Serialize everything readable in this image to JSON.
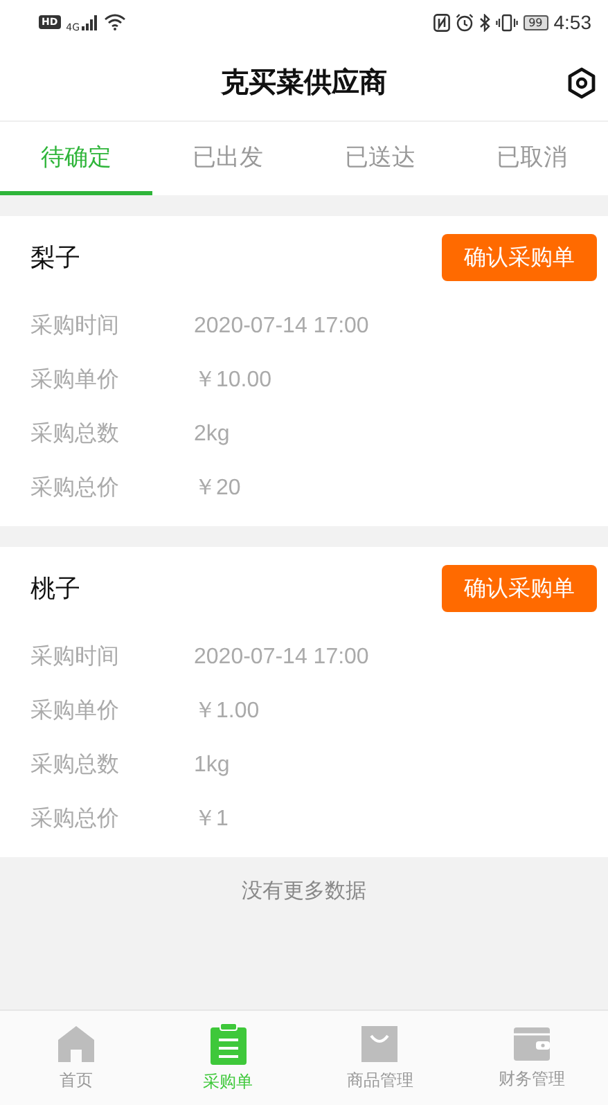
{
  "status_bar": {
    "hd": "HD",
    "network": "4G",
    "battery": "99",
    "time": "4:53"
  },
  "header": {
    "title": "克买菜供应商"
  },
  "tabs": [
    {
      "label": "待确定",
      "selected": true
    },
    {
      "label": "已出发",
      "selected": false
    },
    {
      "label": "已送达",
      "selected": false
    },
    {
      "label": "已取消",
      "selected": false
    }
  ],
  "orders": [
    {
      "name": "梨子",
      "action": "确认采购单",
      "fields": [
        {
          "label": "采购时间",
          "value": "2020-07-14 17:00"
        },
        {
          "label": "采购单价",
          "value": "￥10.00"
        },
        {
          "label": "采购总数",
          "value": "2kg"
        },
        {
          "label": "采购总价",
          "value": "￥20"
        }
      ]
    },
    {
      "name": "桃子",
      "action": "确认采购单",
      "fields": [
        {
          "label": "采购时间",
          "value": "2020-07-14 17:00"
        },
        {
          "label": "采购单价",
          "value": "￥1.00"
        },
        {
          "label": "采购总数",
          "value": "1kg"
        },
        {
          "label": "采购总价",
          "value": "￥1"
        }
      ]
    }
  ],
  "end_note": "没有更多数据",
  "bottom_nav": [
    {
      "label": "首页",
      "kind": "home",
      "selected": false
    },
    {
      "label": "采购单",
      "kind": "orders",
      "selected": true
    },
    {
      "label": "商品管理",
      "kind": "bag",
      "selected": false
    },
    {
      "label": "财务管理",
      "kind": "wallet",
      "selected": false
    }
  ]
}
